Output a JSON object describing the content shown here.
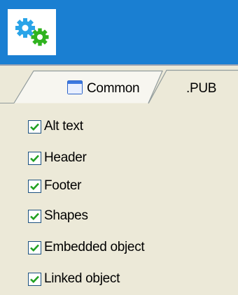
{
  "tabs": [
    {
      "label": "Common",
      "icon": "window-icon",
      "selected": false
    },
    {
      "label": ".PUB",
      "selected": true
    }
  ],
  "options": [
    {
      "label": "Alt text",
      "checked": true
    },
    {
      "label": "Header",
      "checked": true
    },
    {
      "label": "Footer",
      "checked": true
    },
    {
      "label": "Shapes",
      "checked": true
    },
    {
      "label": "Embedded object",
      "checked": true
    },
    {
      "label": "Linked object",
      "checked": true
    }
  ],
  "colors": {
    "header": "#1a7fd2",
    "gear_blue": "#2aa4e8",
    "gear_green": "#2fb31f",
    "check": "#21a121",
    "panel": "#ece9d8"
  }
}
